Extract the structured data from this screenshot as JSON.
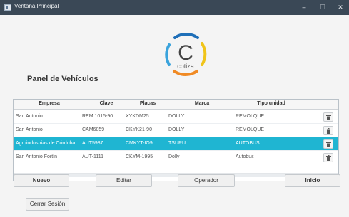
{
  "window": {
    "title": "Ventana Principal",
    "controls": {
      "minimize": "–",
      "maximize": "☐",
      "close": "✕"
    }
  },
  "logo": {
    "letter": "C",
    "text": "cotiza",
    "colors": [
      "#1f6fb8",
      "#f0c419",
      "#3aa3dc",
      "#f08a24"
    ]
  },
  "panel": {
    "title": "Panel de Vehículos"
  },
  "table": {
    "columns": [
      "Empresa",
      "Clave",
      "Placas",
      "Marca",
      "Tipo unidad"
    ],
    "rows": [
      {
        "empresa": "San Antonio",
        "clave": "REM 1015-90",
        "placas": "XYKDM25",
        "marca": "DOLLY",
        "tipo": "REMOLQUE",
        "selected": false
      },
      {
        "empresa": "San Antonio",
        "clave": "CAM6859",
        "placas": "CKYK21-90",
        "marca": "DOLLY",
        "tipo": "REMOLQUE",
        "selected": false
      },
      {
        "empresa": "Agroindustrias de Córdoba",
        "clave": "AUT5987",
        "placas": "CMKYT-IO9",
        "marca": "TSURU",
        "tipo": "AUTOBUS",
        "selected": true
      },
      {
        "empresa": "San Antonio Fortín",
        "clave": "AUT-1111",
        "placas": "CKYM-1995",
        "marca": "Dolly",
        "tipo": "Autobus",
        "selected": false
      }
    ],
    "selected_color": "#1fb5d2"
  },
  "buttons": {
    "nuevo": "Nuevo",
    "editar": "Editar",
    "operador": "Operador",
    "inicio": "Inicio",
    "cerrar_sesion": "Cerrar Sesión"
  }
}
